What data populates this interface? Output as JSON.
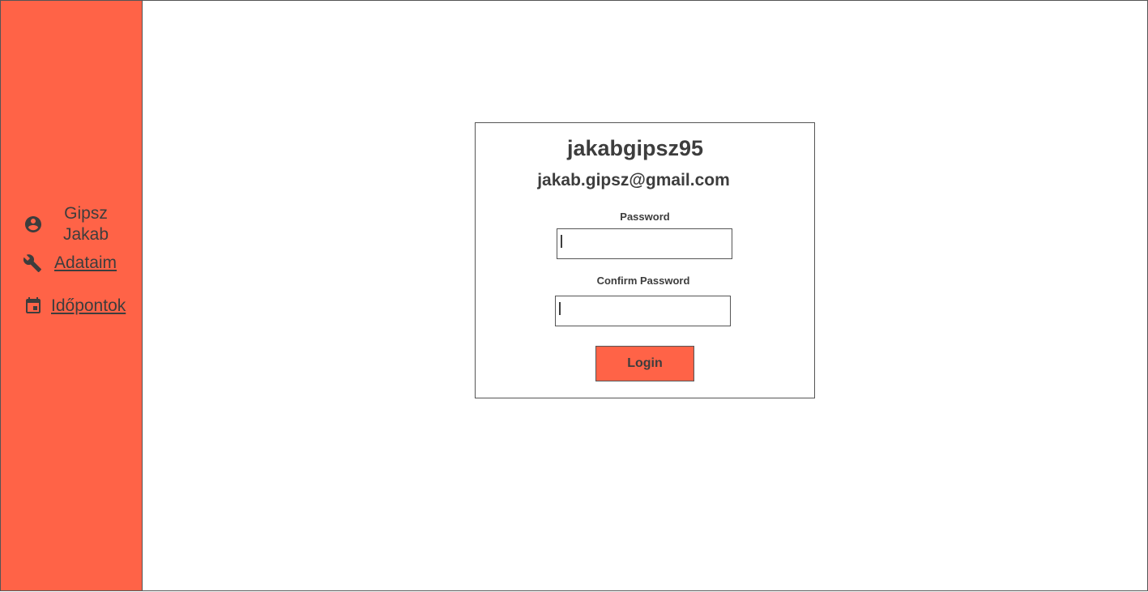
{
  "sidebar": {
    "user": {
      "first_line": "Gipsz",
      "second_line": "Jakab",
      "icon": "account-circle-icon"
    },
    "items": [
      {
        "label": "Adataim",
        "icon": "wrench-icon"
      },
      {
        "label": "Időpontok",
        "icon": "calendar-icon"
      }
    ],
    "background_color": "#ff6347"
  },
  "card": {
    "username": "jakabgipsz95",
    "email": "jakab.gipsz@gmail.com",
    "password": {
      "label": "Password",
      "value": ""
    },
    "confirm_password": {
      "label": "Confirm Password",
      "value": ""
    },
    "login_label": "Login"
  },
  "colors": {
    "accent": "#ff6347",
    "text": "#3d3d3d",
    "border": "#555555"
  }
}
